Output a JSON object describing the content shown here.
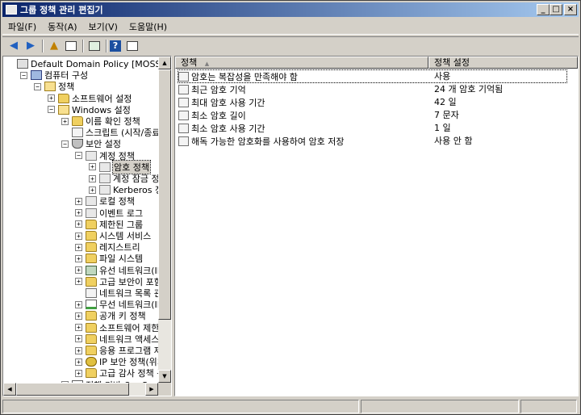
{
  "window": {
    "title": "그룹 정책 관리 편집기",
    "controls": {
      "minimize": "_",
      "maximize": "□",
      "close": "×"
    }
  },
  "menu": [
    "파일(F)",
    "동작(A)",
    "보기(V)",
    "도움말(H)"
  ],
  "toolbar": {
    "back_icon": "◀",
    "forward_icon": "▶",
    "up_icon": "▲",
    "help_icon": "?"
  },
  "tree": {
    "items": [
      {
        "label": "Default Domain Policy [MOSS.AL",
        "level": 0,
        "exp": "",
        "icon": "policy"
      },
      {
        "label": "컴퓨터 구성",
        "level": 1,
        "exp": "−",
        "icon": "computer"
      },
      {
        "label": "정책",
        "level": 2,
        "exp": "−",
        "icon": "folder-open"
      },
      {
        "label": "소프트웨어 설정",
        "level": 3,
        "exp": "+",
        "icon": "folder"
      },
      {
        "label": "Windows 설정",
        "level": 3,
        "exp": "−",
        "icon": "folder-open"
      },
      {
        "label": "이름 확인 정책",
        "level": 4,
        "exp": "+",
        "icon": "folder"
      },
      {
        "label": "스크립트 (시작/종료",
        "level": 4,
        "exp": "",
        "icon": "doc"
      },
      {
        "label": "보안 설정",
        "level": 4,
        "exp": "−",
        "icon": "shield"
      },
      {
        "label": "계정 정책",
        "level": 5,
        "exp": "−",
        "icon": "list"
      },
      {
        "label": "암호 정책",
        "level": 6,
        "exp": "+",
        "icon": "list",
        "selected": true
      },
      {
        "label": "계정 잠금 정책",
        "level": 6,
        "exp": "+",
        "icon": "list"
      },
      {
        "label": "Kerberos 정책",
        "level": 6,
        "exp": "+",
        "icon": "list"
      },
      {
        "label": "로컬 정책",
        "level": 5,
        "exp": "+",
        "icon": "list"
      },
      {
        "label": "이벤트 로그",
        "level": 5,
        "exp": "+",
        "icon": "list"
      },
      {
        "label": "제한된 그룹",
        "level": 5,
        "exp": "+",
        "icon": "folder"
      },
      {
        "label": "시스템 서비스",
        "level": 5,
        "exp": "+",
        "icon": "folder"
      },
      {
        "label": "레지스트리",
        "level": 5,
        "exp": "+",
        "icon": "folder"
      },
      {
        "label": "파일 시스템",
        "level": 5,
        "exp": "+",
        "icon": "folder"
      },
      {
        "label": "유선 네트워크(IE",
        "level": 5,
        "exp": "+",
        "icon": "net"
      },
      {
        "label": "고급 보안이 포함",
        "level": 5,
        "exp": "+",
        "icon": "folder"
      },
      {
        "label": "네트워크 목록 관",
        "level": 5,
        "exp": "",
        "icon": "doc"
      },
      {
        "label": "무선 네트워크(IE",
        "level": 5,
        "exp": "+",
        "icon": "chart"
      },
      {
        "label": "공개 키 정책",
        "level": 5,
        "exp": "+",
        "icon": "folder"
      },
      {
        "label": "소프트웨어 제한",
        "level": 5,
        "exp": "+",
        "icon": "folder"
      },
      {
        "label": "네트워크 액세스",
        "level": 5,
        "exp": "+",
        "icon": "folder"
      },
      {
        "label": "응용 프로그램 제",
        "level": 5,
        "exp": "+",
        "icon": "folder"
      },
      {
        "label": "IP 보안 정책(위치",
        "level": 5,
        "exp": "+",
        "icon": "ip"
      },
      {
        "label": "고급 감사 정책 구",
        "level": 5,
        "exp": "+",
        "icon": "folder"
      },
      {
        "label": "정책 기반 Q o S",
        "level": 4,
        "exp": "+",
        "icon": "chart"
      }
    ]
  },
  "list": {
    "columns": [
      "정책",
      "정책 설정"
    ],
    "sort_indicator": "▲",
    "rows": [
      {
        "policy": "암호는 복잡성을 만족해야 함",
        "setting": "사용"
      },
      {
        "policy": "최근 암호 기억",
        "setting": "24 개 암호 기억됨"
      },
      {
        "policy": "최대 암호 사용 기간",
        "setting": "42 일"
      },
      {
        "policy": "최소 암호 길이",
        "setting": "7 문자"
      },
      {
        "policy": "최소 암호 사용 기간",
        "setting": "1 일"
      },
      {
        "policy": "해독 가능한 암호화를 사용하여 암호 저장",
        "setting": "사용 안 함"
      }
    ]
  },
  "scroll_arrows": {
    "up": "▲",
    "down": "▼",
    "left": "◀",
    "right": "▶"
  }
}
